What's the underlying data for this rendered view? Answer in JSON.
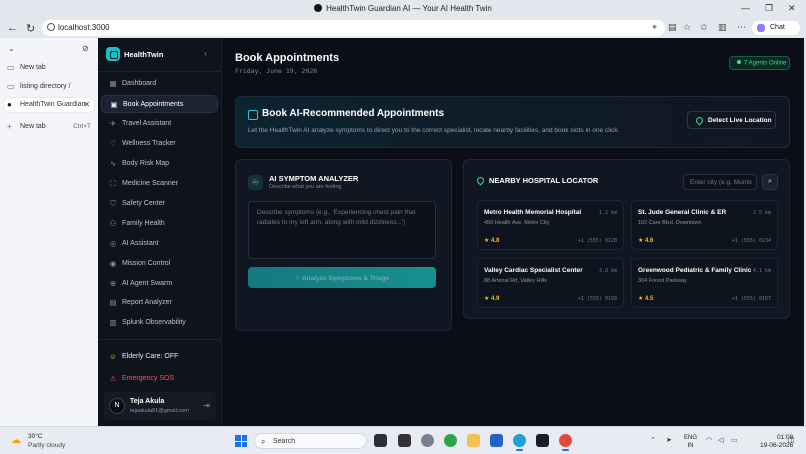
{
  "browser": {
    "window_title": "HealthTwin Guardian AI — Your AI Health Twin",
    "url": "localhost:3000",
    "chat_label": "Chat",
    "tabs": [
      {
        "label": "New tab"
      },
      {
        "label": "listing directory /"
      },
      {
        "label": "HealthTwin Guardian"
      }
    ],
    "new_tab": {
      "label": "New tab",
      "shortcut": "Ctrl+T"
    }
  },
  "app": {
    "brand": "HealthTwin",
    "nav": [
      {
        "label": "Dashboard",
        "icon": "grid-icon"
      },
      {
        "label": "Book Appointments",
        "icon": "calendar-icon",
        "active": true
      },
      {
        "label": "Travel Assistant",
        "icon": "plane-icon"
      },
      {
        "label": "Wellness Tracker",
        "icon": "heart-icon"
      },
      {
        "label": "Body Risk Map",
        "icon": "pulse-icon"
      },
      {
        "label": "Medicine Scanner",
        "icon": "scan-icon"
      },
      {
        "label": "Safety Center",
        "icon": "shield-icon"
      },
      {
        "label": "Family Health",
        "icon": "users-icon"
      },
      {
        "label": "AI Assistant",
        "icon": "globe-icon"
      },
      {
        "label": "Mission Control",
        "icon": "target-icon"
      },
      {
        "label": "AI Agent Swarm",
        "icon": "network-icon"
      },
      {
        "label": "Report Analyzer",
        "icon": "file-icon"
      },
      {
        "label": "Splunk Observability",
        "icon": "chart-icon"
      }
    ],
    "elderly_care": "Elderly Care: OFF",
    "emergency_sos": "Emergency SOS",
    "user": {
      "initial": "N",
      "name": "Teja Akula",
      "email": "tejaakula81@gmail.com"
    }
  },
  "main": {
    "title": "Book Appointments",
    "date": "Friday, June 19, 2026",
    "agents_badge": "7 Agents Online",
    "hero": {
      "title": "Book AI-Recommended Appointments",
      "description": "Let the HealthTwin AI analyze symptoms to direct you to the correct specialist, locate nearby facilities, and book slots in one click.",
      "detect_button": "Detect Live Location"
    },
    "symptom_analyzer": {
      "title": "AI SYMPTOM ANALYZER",
      "subtitle": "Describe what you are feeling",
      "placeholder": "Describe symptoms (e.g., 'Experiencing chest pain that radiates to my left arm, along with mild dizziness...')",
      "button": "Analyze Symptoms & Triage"
    },
    "hospital_locator": {
      "title": "NEARBY HOSPITAL LOCATOR",
      "city_placeholder": "Enter city (e.g. Mumb",
      "hospitals": [
        {
          "name": "Metro Health Memorial Hospital",
          "distance": "1.2 km",
          "address": "450 Health Ave, Metro City",
          "rating": "★ 4.8",
          "phone": "+1 (555) 0120"
        },
        {
          "name": "St. Jude General Clinic & ER",
          "distance": "2.5 km",
          "address": "102 Care Blvd, Downtown",
          "rating": "★ 4.6",
          "phone": "+1 (555) 0134"
        },
        {
          "name": "Valley Cardiac Specialist Center",
          "distance": "3.8 km",
          "address": "88 Arterial Rd, Valley Hills",
          "rating": "★ 4.9",
          "phone": "+1 (555) 0199"
        },
        {
          "name": "Greenwood Pediatric & Family Clinic",
          "distance": "4.1 km",
          "address": "304 Forest Parkway",
          "rating": "★ 4.5",
          "phone": "+1 (555) 0167"
        }
      ]
    }
  },
  "taskbar": {
    "weather_temp": "30°C",
    "weather_desc": "Partly cloudy",
    "search_label": "Search",
    "lang_line1": "ENG",
    "lang_line2": "IN",
    "time": "01:08",
    "date": "19-06-2026"
  },
  "colors": {
    "accent": "#19c0c8",
    "sos": "#ff4f5e",
    "online": "#3fdc95",
    "rating": "#f5b829",
    "app_bg": "#0b0e16"
  }
}
